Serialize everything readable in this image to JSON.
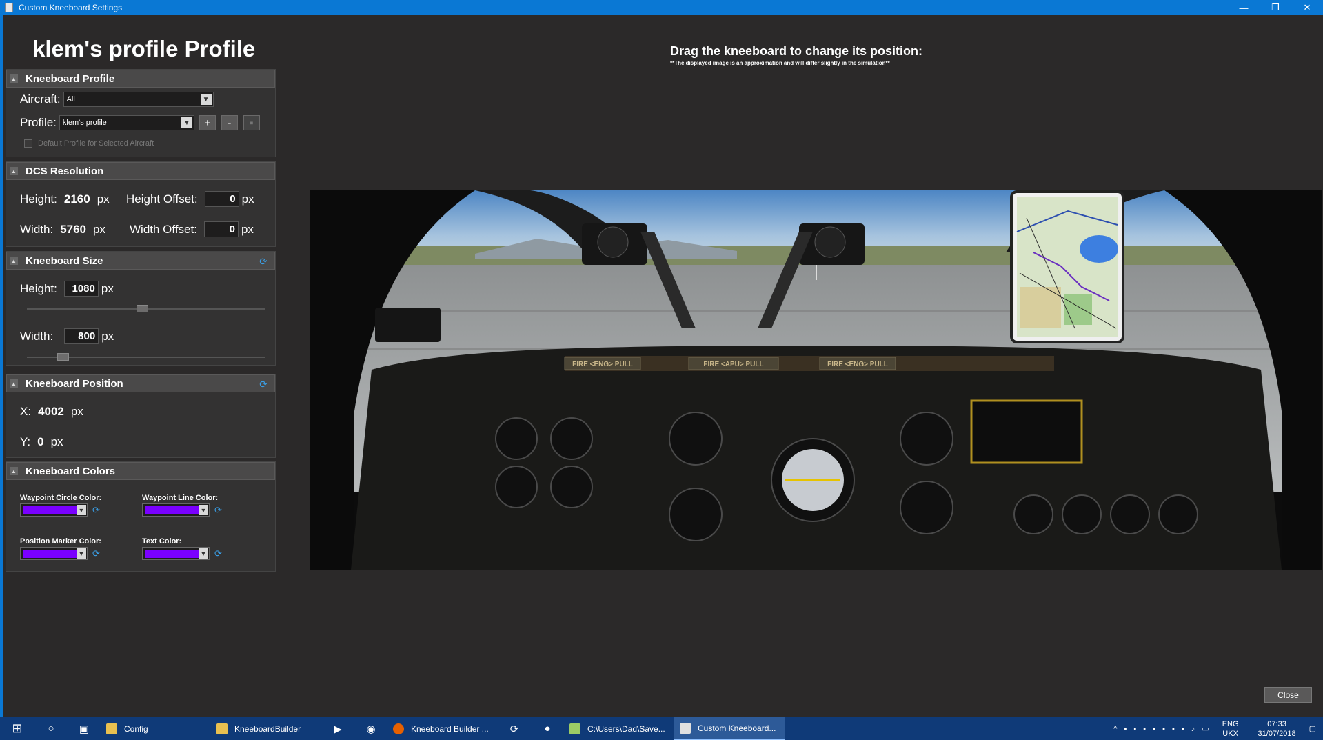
{
  "window": {
    "title": "Custom Kneeboard Settings",
    "min": "—",
    "max": "❐",
    "close": "✕"
  },
  "profile_title": "klem's profile Profile",
  "sections": {
    "kneeboard_profile": {
      "title": "Kneeboard Profile",
      "aircraft_label": "Aircraft:",
      "aircraft_value": "All",
      "profile_label": "Profile:",
      "profile_value": "klem's profile",
      "add": "+",
      "remove": "-",
      "default_label": "Default Profile for Selected Aircraft"
    },
    "dcs_resolution": {
      "title": "DCS Resolution",
      "height_label": "Height:",
      "height_value": "2160",
      "width_label": "Width:",
      "width_value": "5760",
      "unit": "px",
      "height_offset_label": "Height Offset:",
      "height_offset_value": "0",
      "width_offset_label": "Width Offset:",
      "width_offset_value": "0"
    },
    "kneeboard_size": {
      "title": "Kneeboard Size",
      "height_label": "Height:",
      "height_value": "1080",
      "width_label": "Width:",
      "width_value": "800",
      "unit": "px"
    },
    "kneeboard_position": {
      "title": "Kneeboard Position",
      "x_label": "X:",
      "x_value": "4002",
      "y_label": "Y:",
      "y_value": "0",
      "unit": "px"
    },
    "kneeboard_colors": {
      "title": "Kneeboard Colors",
      "waypoint_circle_label": "Waypoint Circle Color:",
      "waypoint_line_label": "Waypoint Line Color:",
      "position_marker_label": "Position Marker Color:",
      "text_color_label": "Text Color:",
      "swatch_color": "#7a00ff"
    }
  },
  "drag_title": "Drag the kneeboard to change its position:",
  "drag_note": "**The displayed image is an approximation and will differ slightly in the simulation**",
  "preview": {
    "panel_labels": {
      "fire_left": "FIRE <ENG> PULL",
      "fire_apu": "FIRE <APU> PULL",
      "fire_right": "FIRE <ENG> PULL"
    }
  },
  "close_label": "Close",
  "taskbar": {
    "items": [
      {
        "label": "Config"
      },
      {
        "label": "KneeboardBuilder"
      },
      {
        "label": "Kneeboard Builder ..."
      },
      {
        "label": "C:\\Users\\Dad\\Save..."
      },
      {
        "label": "Custom Kneeboard..."
      }
    ],
    "lang": "ENG",
    "layout": "UKX",
    "time": "07:33",
    "date": "31/07/2018"
  }
}
